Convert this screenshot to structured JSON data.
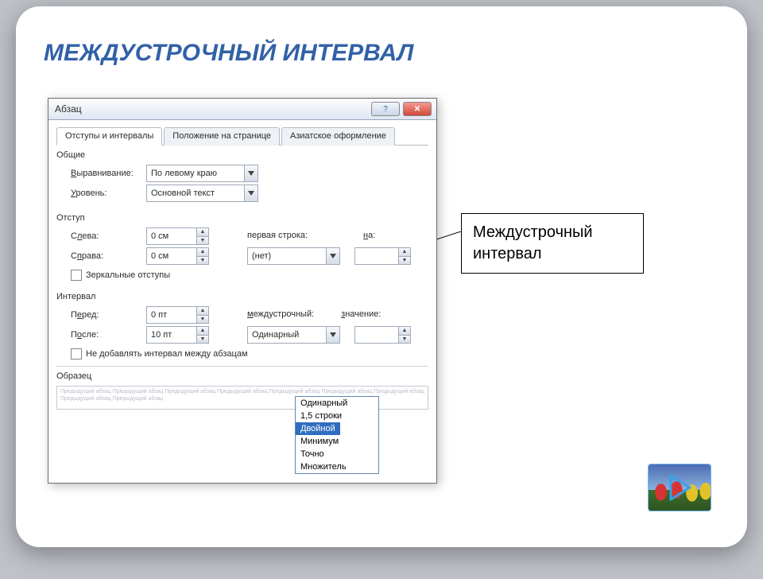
{
  "slide": {
    "title": "МЕЖДУСТРОЧНЫЙ ИНТЕРВАЛ"
  },
  "callout": {
    "text": "Междустрочный интервал"
  },
  "dialog": {
    "title": "Абзац",
    "tabs": [
      "Отступы и интервалы",
      "Положение на странице",
      "Азиатское оформление"
    ],
    "general": {
      "header": "Общие",
      "align_label": "Выравнивание:",
      "align_value": "По левому краю",
      "level_label": "Уровень:",
      "level_value": "Основной текст"
    },
    "indent": {
      "header": "Отступ",
      "left_label": "Слева:",
      "left_value": "0 см",
      "right_label": "Справа:",
      "right_value": "0 см",
      "firstline_label": "первая строка:",
      "firstline_value": "(нет)",
      "by_label": "на:",
      "mirror": "Зеркальные отступы"
    },
    "spacing": {
      "header": "Интервал",
      "before_label": "Перед:",
      "before_value": "0 пт",
      "after_label": "После:",
      "after_value": "10 пт",
      "line_label": "междустрочный:",
      "line_value": "Одинарный",
      "value_label": "значение:",
      "noaddspace": "Не добавлять интервал между абзацам",
      "options": [
        "Одинарный",
        "1,5 строки",
        "Двойной",
        "Минимум",
        "Точно",
        "Множитель"
      ],
      "selected_option": "Двойной"
    },
    "sample": {
      "header": "Образец",
      "filler": "Предыдущий абзац Предыдущий абзац Предыдущий абзац Предыдущий абзац Предыдущий абзац Предыдущий абзац Предыдущий абзац Предыдущий абзац Предыдущий абзац"
    }
  }
}
